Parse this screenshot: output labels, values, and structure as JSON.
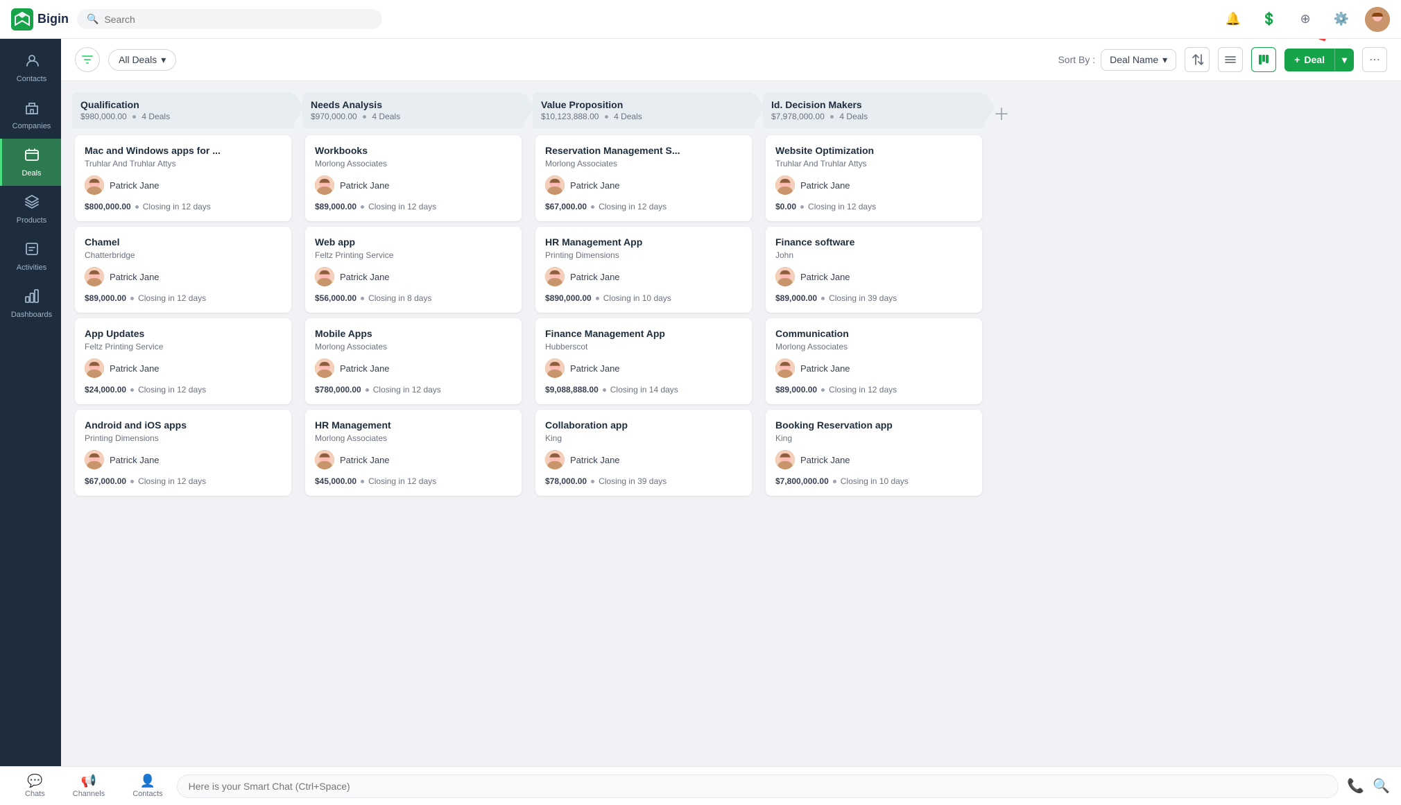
{
  "app": {
    "name": "Bigin",
    "logo": "🔷"
  },
  "search": {
    "placeholder": "Search"
  },
  "sidebar": {
    "items": [
      {
        "id": "contacts",
        "label": "Contacts",
        "icon": "👤"
      },
      {
        "id": "companies",
        "label": "Companies",
        "icon": "🏢"
      },
      {
        "id": "deals",
        "label": "Deals",
        "icon": "💼",
        "active": true
      },
      {
        "id": "products",
        "label": "Products",
        "icon": "📦"
      },
      {
        "id": "activities",
        "label": "Activities",
        "icon": "📋"
      },
      {
        "id": "dashboards",
        "label": "Dashboards",
        "icon": "📊"
      }
    ]
  },
  "toolbar": {
    "filter_label": "All Deals",
    "sort_label": "Sort By :",
    "sort_value": "Deal Name",
    "add_deal_label": "+ Deal",
    "add_deal_prefix": "+"
  },
  "columns": [
    {
      "id": "qualification",
      "title": "Qualification",
      "amount": "$980,000.00",
      "deal_count": "4 Deals",
      "cards": [
        {
          "name": "Mac and Windows apps for ...",
          "company": "Truhlar And Truhlar Attys",
          "owner": "Patrick Jane",
          "amount": "$800,000.00",
          "closing": "Closing in 12 days"
        },
        {
          "name": "Chamel",
          "company": "Chatterbridge",
          "owner": "Patrick Jane",
          "amount": "$89,000.00",
          "closing": "Closing in 12 days"
        },
        {
          "name": "App Updates",
          "company": "Feltz Printing Service",
          "owner": "Patrick Jane",
          "amount": "$24,000.00",
          "closing": "Closing in 12 days"
        },
        {
          "name": "Android and iOS apps",
          "company": "Printing Dimensions",
          "owner": "Patrick Jane",
          "amount": "$67,000.00",
          "closing": "Closing in 12 days"
        }
      ]
    },
    {
      "id": "needs_analysis",
      "title": "Needs Analysis",
      "amount": "$970,000.00",
      "deal_count": "4 Deals",
      "cards": [
        {
          "name": "Workbooks",
          "company": "Morlong Associates",
          "owner": "Patrick Jane",
          "amount": "$89,000.00",
          "closing": "Closing in 12 days"
        },
        {
          "name": "Web app",
          "company": "Feltz Printing Service",
          "owner": "Patrick Jane",
          "amount": "$56,000.00",
          "closing": "Closing in 8 days"
        },
        {
          "name": "Mobile Apps",
          "company": "Morlong Associates",
          "owner": "Patrick Jane",
          "amount": "$780,000.00",
          "closing": "Closing in 12 days"
        },
        {
          "name": "HR Management",
          "company": "Morlong Associates",
          "owner": "Patrick Jane",
          "amount": "$45,000.00",
          "closing": "Closing in 12 days"
        }
      ]
    },
    {
      "id": "value_proposition",
      "title": "Value Proposition",
      "amount": "$10,123,888.00",
      "deal_count": "4 Deals",
      "cards": [
        {
          "name": "Reservation Management S...",
          "company": "Morlong Associates",
          "owner": "Patrick Jane",
          "amount": "$67,000.00",
          "closing": "Closing in 12 days"
        },
        {
          "name": "HR Management App",
          "company": "Printing Dimensions",
          "owner": "Patrick Jane",
          "amount": "$890,000.00",
          "closing": "Closing in 10 days"
        },
        {
          "name": "Finance Management App",
          "company": "Hubberscot",
          "owner": "Patrick Jane",
          "amount": "$9,088,888.00",
          "closing": "Closing in 14 days"
        },
        {
          "name": "Collaboration app",
          "company": "King",
          "owner": "Patrick Jane",
          "amount": "$78,000.00",
          "closing": "Closing in 39 days"
        }
      ]
    },
    {
      "id": "id_decision_makers",
      "title": "Id. Decision Makers",
      "amount": "$7,978,000.00",
      "deal_count": "4 Deals",
      "cards": [
        {
          "name": "Website Optimization",
          "company": "Truhlar And Truhlar Attys",
          "owner": "Patrick Jane",
          "amount": "$0.00",
          "closing": "Closing in 12 days"
        },
        {
          "name": "Finance software",
          "company": "John",
          "owner": "Patrick Jane",
          "amount": "$89,000.00",
          "closing": "Closing in 39 days"
        },
        {
          "name": "Communication",
          "company": "Morlong Associates",
          "owner": "Patrick Jane",
          "amount": "$89,000.00",
          "closing": "Closing in 12 days"
        },
        {
          "name": "Booking Reservation app",
          "company": "King",
          "owner": "Patrick Jane",
          "amount": "$7,800,000.00",
          "closing": "Closing in 10 days"
        }
      ]
    }
  ],
  "bottombar": {
    "chats_label": "Chats",
    "channels_label": "Channels",
    "contacts_label": "Contacts",
    "chat_placeholder": "Here is your Smart Chat (Ctrl+Space)"
  }
}
